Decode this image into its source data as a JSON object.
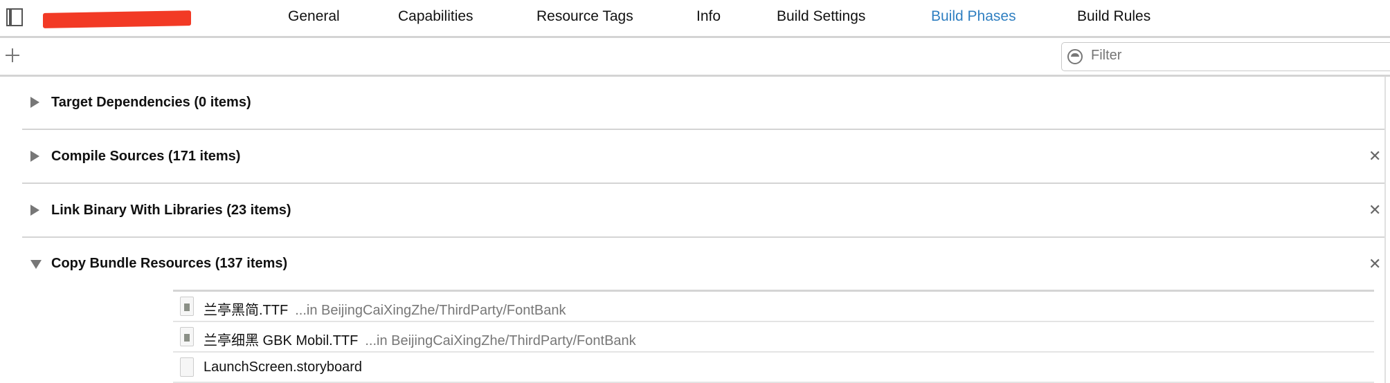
{
  "tabs": [
    {
      "label": "General"
    },
    {
      "label": "Capabilities"
    },
    {
      "label": "Resource Tags"
    },
    {
      "label": "Info"
    },
    {
      "label": "Build Settings"
    },
    {
      "label": "Build Phases",
      "active": true
    },
    {
      "label": "Build Rules"
    }
  ],
  "accent_color": "#2f7fc1",
  "filter": {
    "placeholder": "Filter"
  },
  "sections": [
    {
      "title": "Target Dependencies (0 items)",
      "expanded": false,
      "closable": false
    },
    {
      "title": "Compile Sources (171 items)",
      "expanded": false,
      "closable": true
    },
    {
      "title": "Link Binary With Libraries (23 items)",
      "expanded": false,
      "closable": true
    },
    {
      "title": "Copy Bundle Resources (137 items)",
      "expanded": true,
      "closable": true
    }
  ],
  "files": [
    {
      "name": "兰亭黑简.TTF",
      "path": "...in BeijingCaiXingZhe/ThirdParty/FontBank",
      "icon": "font-file-icon"
    },
    {
      "name": "兰亭细黑 GBK Mobil.TTF",
      "path": "...in BeijingCaiXingZhe/ThirdParty/FontBank",
      "icon": "font-file-icon"
    },
    {
      "name": "LaunchScreen.storyboard",
      "path": "",
      "icon": "storyboard-file-icon"
    }
  ]
}
